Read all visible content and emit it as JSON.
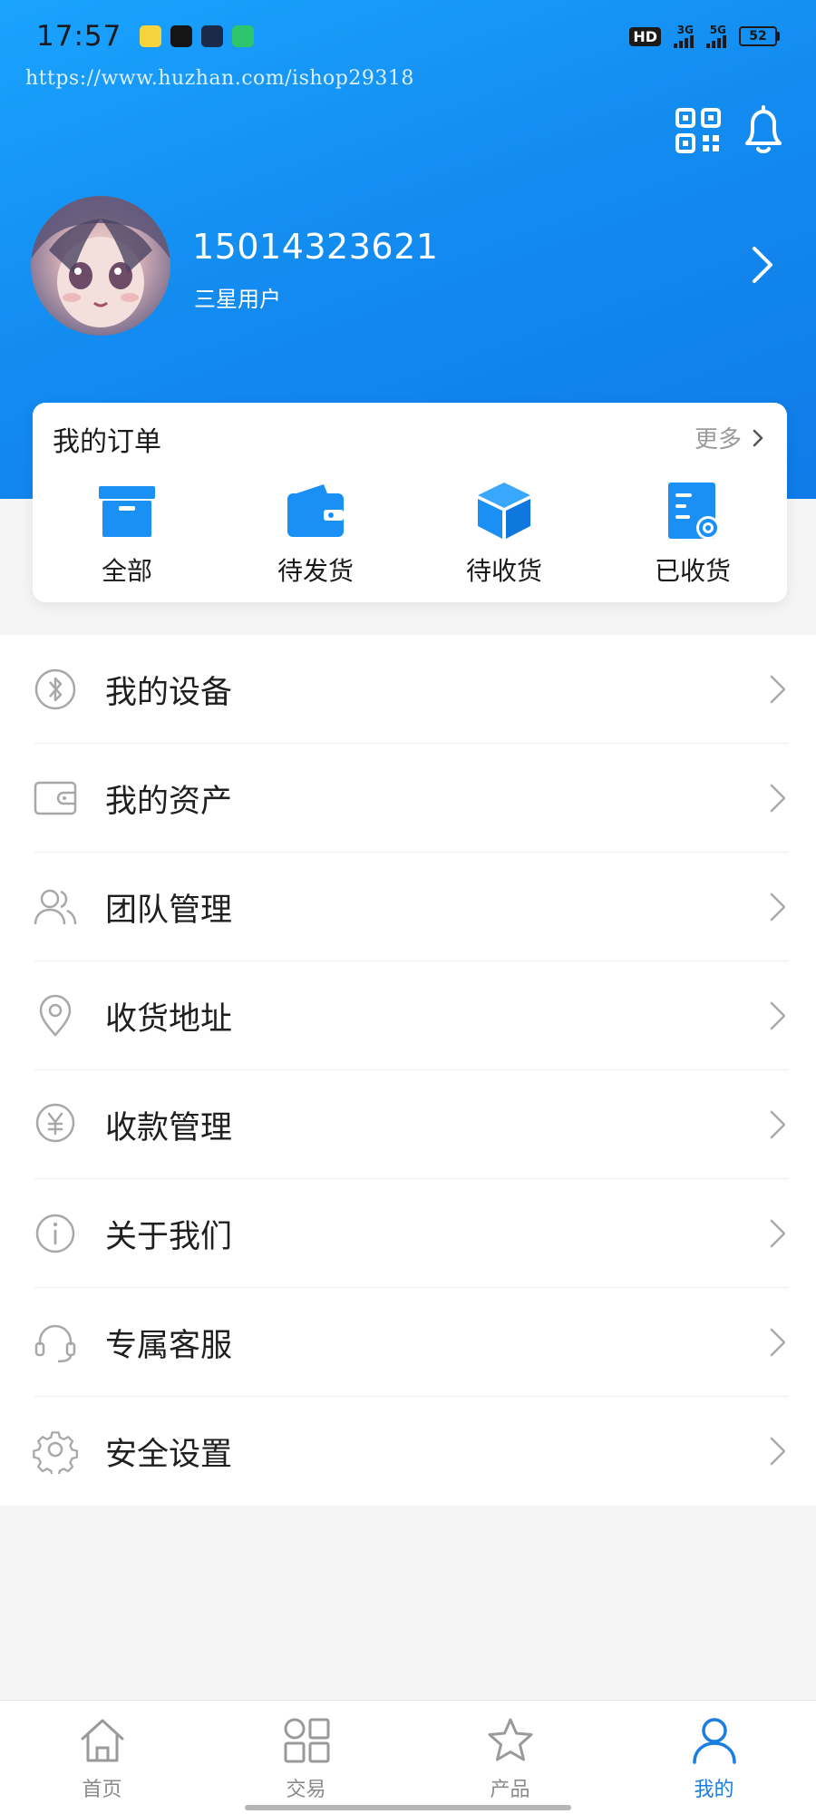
{
  "status_bar": {
    "time": "17:57",
    "hd_label": "HD",
    "signal_1_label": "3G",
    "signal_2_label": "5G",
    "battery": "52"
  },
  "watermark": "https://www.huzhan.com/ishop29318",
  "profile": {
    "phone": "15014323621",
    "level": "三星用户"
  },
  "orders": {
    "title": "我的订单",
    "more_label": "更多",
    "items": [
      {
        "label": "全部",
        "icon": "box-icon"
      },
      {
        "label": "待发货",
        "icon": "wallet-icon"
      },
      {
        "label": "待收货",
        "icon": "cube-icon"
      },
      {
        "label": "已收货",
        "icon": "document-gear-icon"
      }
    ]
  },
  "menu": {
    "items": [
      {
        "label": "我的设备",
        "icon": "bluetooth-icon"
      },
      {
        "label": "我的资产",
        "icon": "wallet-outline-icon"
      },
      {
        "label": "团队管理",
        "icon": "team-icon"
      },
      {
        "label": "收货地址",
        "icon": "location-icon"
      },
      {
        "label": "收款管理",
        "icon": "yuan-icon"
      },
      {
        "label": "关于我们",
        "icon": "info-icon"
      },
      {
        "label": "专属客服",
        "icon": "headset-icon"
      },
      {
        "label": "安全设置",
        "icon": "gear-icon"
      }
    ]
  },
  "tabbar": {
    "items": [
      {
        "label": "首页",
        "icon": "home-icon",
        "active": false
      },
      {
        "label": "交易",
        "icon": "grid-icon",
        "active": false
      },
      {
        "label": "产品",
        "icon": "star-icon",
        "active": false
      },
      {
        "label": "我的",
        "icon": "user-icon",
        "active": true
      }
    ]
  },
  "colors": {
    "primary": "#1a7fe0",
    "header_start": "#1aa3ff",
    "header_end": "#0f7be8",
    "menu_icon": "#a8a8a8",
    "tab_inactive": "#8a8a8a"
  }
}
